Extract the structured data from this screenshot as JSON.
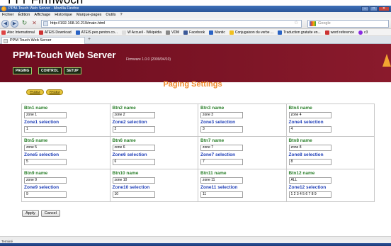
{
  "browser": {
    "window_title": "PPM-Touch Web Server - Mozilla Firefox",
    "menu": [
      "Fichier",
      "Édition",
      "Affichage",
      "Historique",
      "Marque-pages",
      "Outils",
      "?"
    ],
    "url": "http://192.168.10.219/main.html",
    "search_placeholder": "Google",
    "bookmarks": [
      "Atec International",
      "ATEIS Download",
      "ATEIS peo.penton.co...",
      "W Accueil - Wikipédia",
      "VDM",
      "Facebook",
      "Mantic",
      "Conjugaison du verbe ...",
      "Traduction gratuite en...",
      "word reference",
      "c3"
    ],
    "tab_label": "PPM Touch Web Server",
    "status_text": "Terminé"
  },
  "header": {
    "title": "PPM-Touch Web Server",
    "firmware": "Firmware 1.0.0 (2009/04/10)",
    "nav": [
      "PAGING",
      "CONTROL",
      "SETUP"
    ]
  },
  "main": {
    "heading": "Paging Settings",
    "page_tabs": [
      "PAGE2",
      "PAGE3"
    ],
    "buttons": [
      {
        "name_label": "Btn1 name",
        "name_value": "zone 1",
        "sel_label": "Zone1 selection",
        "sel_value": "1"
      },
      {
        "name_label": "Btn2 name",
        "name_value": "zone 2",
        "sel_label": "Zone2 selection",
        "sel_value": "2"
      },
      {
        "name_label": "Btn3 name",
        "name_value": "zone 3",
        "sel_label": "Zone3 selection",
        "sel_value": "3"
      },
      {
        "name_label": "Btn4 name",
        "name_value": "zone 4",
        "sel_label": "Zone4 selection",
        "sel_value": "4"
      },
      {
        "name_label": "Btn5 name",
        "name_value": "zone 5",
        "sel_label": "Zone5 selection",
        "sel_value": "5"
      },
      {
        "name_label": "Btn6 name",
        "name_value": "zone 6",
        "sel_label": "Zone6 selection",
        "sel_value": "6"
      },
      {
        "name_label": "Btn7 name",
        "name_value": "zone 7",
        "sel_label": "Zone7 selection",
        "sel_value": "7"
      },
      {
        "name_label": "Btn8 name",
        "name_value": "zone 8",
        "sel_label": "Zone8 selection",
        "sel_value": "8"
      },
      {
        "name_label": "Btn9 name",
        "name_value": "zone 9",
        "sel_label": "Zone9 selection",
        "sel_value": "9"
      },
      {
        "name_label": "Btn10 name",
        "name_value": "zone 10",
        "sel_label": "Zone10 selection",
        "sel_value": "10"
      },
      {
        "name_label": "Btn11 name",
        "name_value": "zone 11",
        "sel_label": "Zone11 selection",
        "sel_value": "11"
      },
      {
        "name_label": "Btn12 name",
        "name_value": "ALL",
        "sel_label": "Zone12 selection",
        "sel_value": "1 2 3 4 5 6 7 8 9"
      }
    ],
    "apply_label": "Apply",
    "cancel_label": "Cancel"
  },
  "colors": {
    "banner": "#7d1526",
    "heading": "#ef8a2c",
    "name_label": "#2a7f2a",
    "selection_label": "#1f3fb8",
    "page_tab": "#e6c53a"
  }
}
